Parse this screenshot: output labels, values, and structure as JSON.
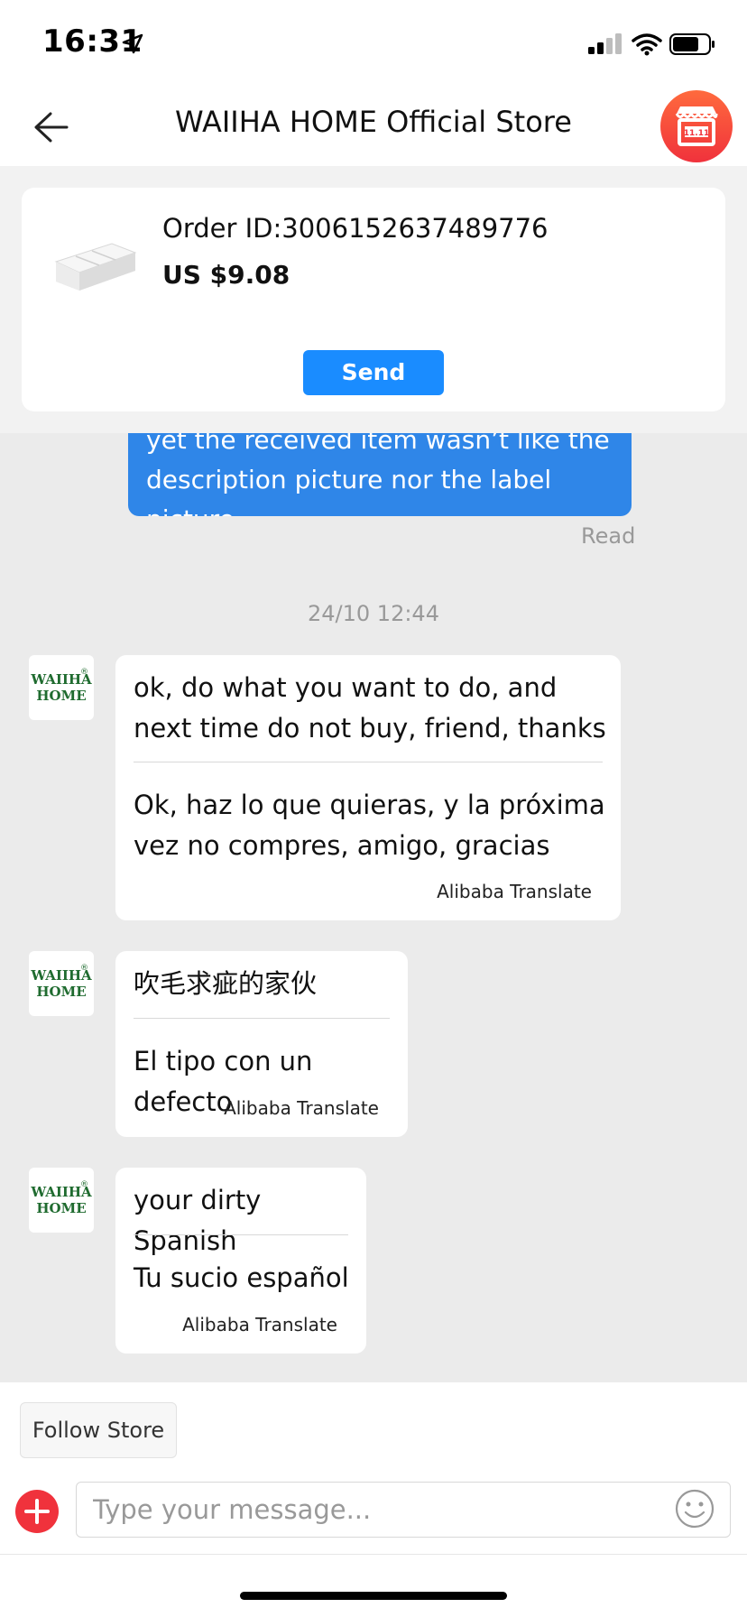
{
  "status_bar": {
    "time": "16:31",
    "icons": [
      "location-arrow-icon",
      "signal-icon",
      "wifi-icon",
      "battery-icon"
    ]
  },
  "header": {
    "title": "WAIIHA HOME Official Store",
    "back_icon": "arrow-left-icon",
    "store_icon": "storefront-icon"
  },
  "order": {
    "order_id": "Order ID:3006152637489776",
    "price": "US $9.08",
    "send_label": "Send"
  },
  "sent_message": {
    "text": "yet the received item wasn’t like the description picture nor the label picture",
    "status": "Read"
  },
  "timestamp": "24/10 12:44",
  "store_avatar": {
    "logo_line1": "WAIIHA",
    "logo_line2": "HOME",
    "logo_reg": "®"
  },
  "messages": [
    {
      "original": "ok, do what you want to do, and next time do not buy, friend, thanks",
      "translation": "Ok, haz lo que quieras, y la próxima vez no compres, amigo, gracias",
      "translator": "Alibaba Translate"
    },
    {
      "original": "吹毛求疵的家伙",
      "translation": "El tipo con un defecto",
      "translator": "Alibaba Translate"
    },
    {
      "original": "your dirty Spanish",
      "translation": "Tu sucio español",
      "translator": "Alibaba Translate"
    }
  ],
  "footer": {
    "follow_label": "Follow Store",
    "input_placeholder": "Type your message...",
    "plus_icon": "plus-circle-icon",
    "emoji_icon": "smiley-icon"
  },
  "colors": {
    "accent_blue": "#1a8cff",
    "sent_bubble": "#2f86e8",
    "plus_red": "#f0323c",
    "logo_green": "#1f6b2f"
  }
}
